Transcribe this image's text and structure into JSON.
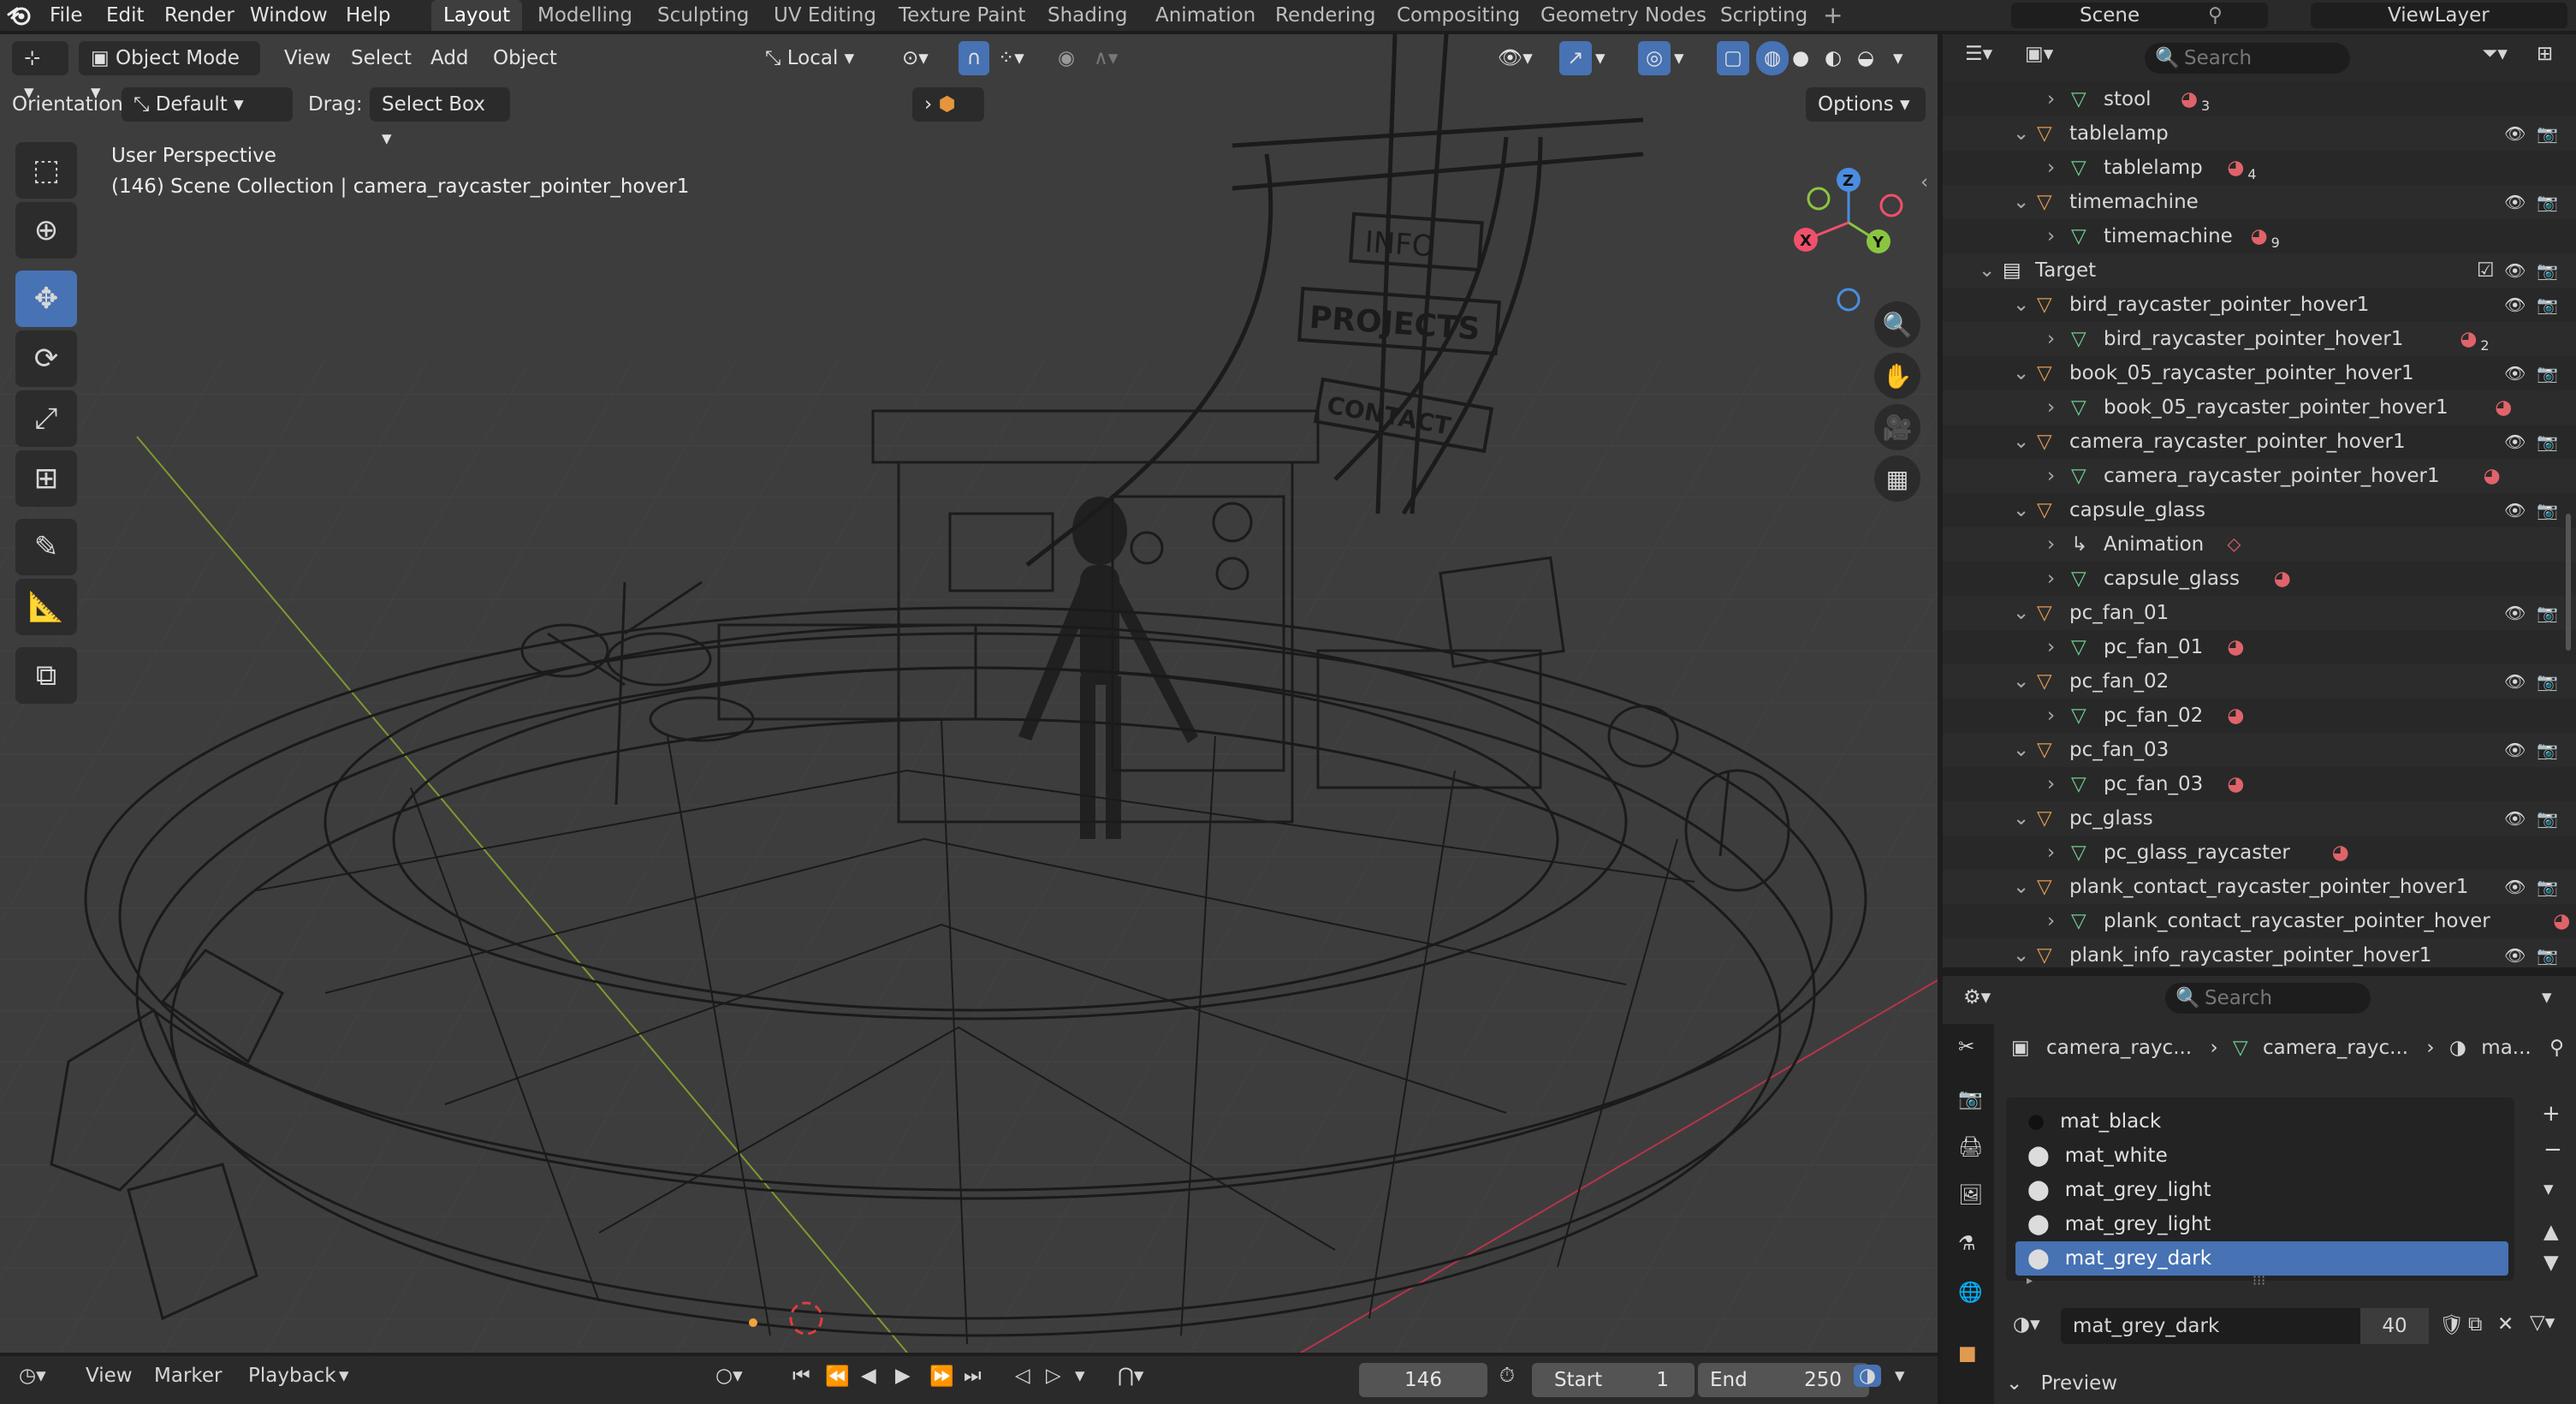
{
  "menubar": {
    "items": [
      "File",
      "Edit",
      "Render",
      "Window",
      "Help"
    ],
    "workspaces": [
      "Layout",
      "Modelling",
      "Sculpting",
      "UV Editing",
      "Texture Paint",
      "Shading",
      "Animation",
      "Rendering",
      "Compositing",
      "Geometry Nodes",
      "Scripting"
    ],
    "active_workspace": "Layout",
    "add_tab_symbol": "+",
    "scene_name": "Scene",
    "view_layer_name": "ViewLayer"
  },
  "viewport_header": {
    "mode": "Object Mode",
    "menus": [
      "View",
      "Select",
      "Add",
      "Object"
    ],
    "transform_orientation": "Local",
    "orientation_label": "Orientation:",
    "orientation_value": "Default",
    "drag_label": "Drag:",
    "drag_value": "Select Box",
    "options_label": "Options"
  },
  "viewport": {
    "perspective_label": "User Perspective",
    "context_label": "(146) Scene Collection | camera_raycaster_pointer_hover1",
    "gizmo_axes": [
      "X",
      "Y",
      "Z"
    ],
    "scene_signs": [
      "INFO",
      "PROJECTS",
      "CONTACT"
    ]
  },
  "outliner": {
    "search_placeholder": "Search",
    "rows": [
      {
        "name": "stool",
        "level": 2,
        "kind": "mesh",
        "extra": "3"
      },
      {
        "name": "tablelamp",
        "level": 1,
        "kind": "object",
        "extra": ""
      },
      {
        "name": "tablelamp",
        "level": 2,
        "kind": "mesh",
        "extra": "4"
      },
      {
        "name": "timemachine",
        "level": 1,
        "kind": "object",
        "extra": ""
      },
      {
        "name": "timemachine",
        "level": 2,
        "kind": "mesh",
        "extra": "9"
      },
      {
        "name": "Target",
        "level": 0,
        "kind": "collection",
        "extra": ""
      },
      {
        "name": "bird_raycaster_pointer_hover1",
        "level": 1,
        "kind": "object",
        "extra": ""
      },
      {
        "name": "bird_raycaster_pointer_hover1",
        "level": 2,
        "kind": "mesh",
        "extra": "2"
      },
      {
        "name": "book_05_raycaster_pointer_hover1",
        "level": 1,
        "kind": "object",
        "extra": ""
      },
      {
        "name": "book_05_raycaster_pointer_hover1",
        "level": 2,
        "kind": "mesh",
        "extra": ""
      },
      {
        "name": "camera_raycaster_pointer_hover1",
        "level": 1,
        "kind": "object",
        "extra": ""
      },
      {
        "name": "camera_raycaster_pointer_hover1",
        "level": 2,
        "kind": "mesh",
        "extra": ""
      },
      {
        "name": "capsule_glass",
        "level": 1,
        "kind": "object",
        "extra": ""
      },
      {
        "name": "Animation",
        "level": 2,
        "kind": "anim",
        "extra": ""
      },
      {
        "name": "capsule_glass",
        "level": 2,
        "kind": "mesh",
        "extra": ""
      },
      {
        "name": "pc_fan_01",
        "level": 1,
        "kind": "object",
        "extra": ""
      },
      {
        "name": "pc_fan_01",
        "level": 2,
        "kind": "mesh",
        "extra": ""
      },
      {
        "name": "pc_fan_02",
        "level": 1,
        "kind": "object",
        "extra": ""
      },
      {
        "name": "pc_fan_02",
        "level": 2,
        "kind": "mesh",
        "extra": ""
      },
      {
        "name": "pc_fan_03",
        "level": 1,
        "kind": "object",
        "extra": ""
      },
      {
        "name": "pc_fan_03",
        "level": 2,
        "kind": "mesh",
        "extra": ""
      },
      {
        "name": "pc_glass",
        "level": 1,
        "kind": "object",
        "extra": ""
      },
      {
        "name": "pc_glass_raycaster",
        "level": 2,
        "kind": "mesh",
        "extra": ""
      },
      {
        "name": "plank_contact_raycaster_pointer_hover1",
        "level": 1,
        "kind": "object",
        "extra": ""
      },
      {
        "name": "plank_contact_raycaster_pointer_hover",
        "level": 2,
        "kind": "mesh",
        "extra": ""
      },
      {
        "name": "plank_info_raycaster_pointer_hover1",
        "level": 1,
        "kind": "object",
        "extra": ""
      }
    ]
  },
  "properties": {
    "search_placeholder": "Search",
    "breadcrumb": [
      "camera_rayc...",
      "camera_rayc...",
      "ma..."
    ],
    "materials": [
      "mat_black",
      "mat_white",
      "mat_grey_light",
      "mat_grey_light",
      "mat_grey_dark"
    ],
    "selected_material_index": 4,
    "active_material": "mat_grey_dark",
    "user_count": "40",
    "preview_label": "Preview"
  },
  "timeline": {
    "menus": [
      "View",
      "Marker",
      "Playback"
    ],
    "current_frame": "146",
    "start_label": "Start",
    "start_value": "1",
    "end_label": "End",
    "end_value": "250"
  },
  "colors": {
    "accent": "#4772b3",
    "object_orange": "#e09a4f",
    "mesh_green": "#6fcf8f",
    "material_red": "#e0636b",
    "axis_x": "#f0506b",
    "axis_y": "#8bc540",
    "axis_z": "#4a8ee0"
  }
}
